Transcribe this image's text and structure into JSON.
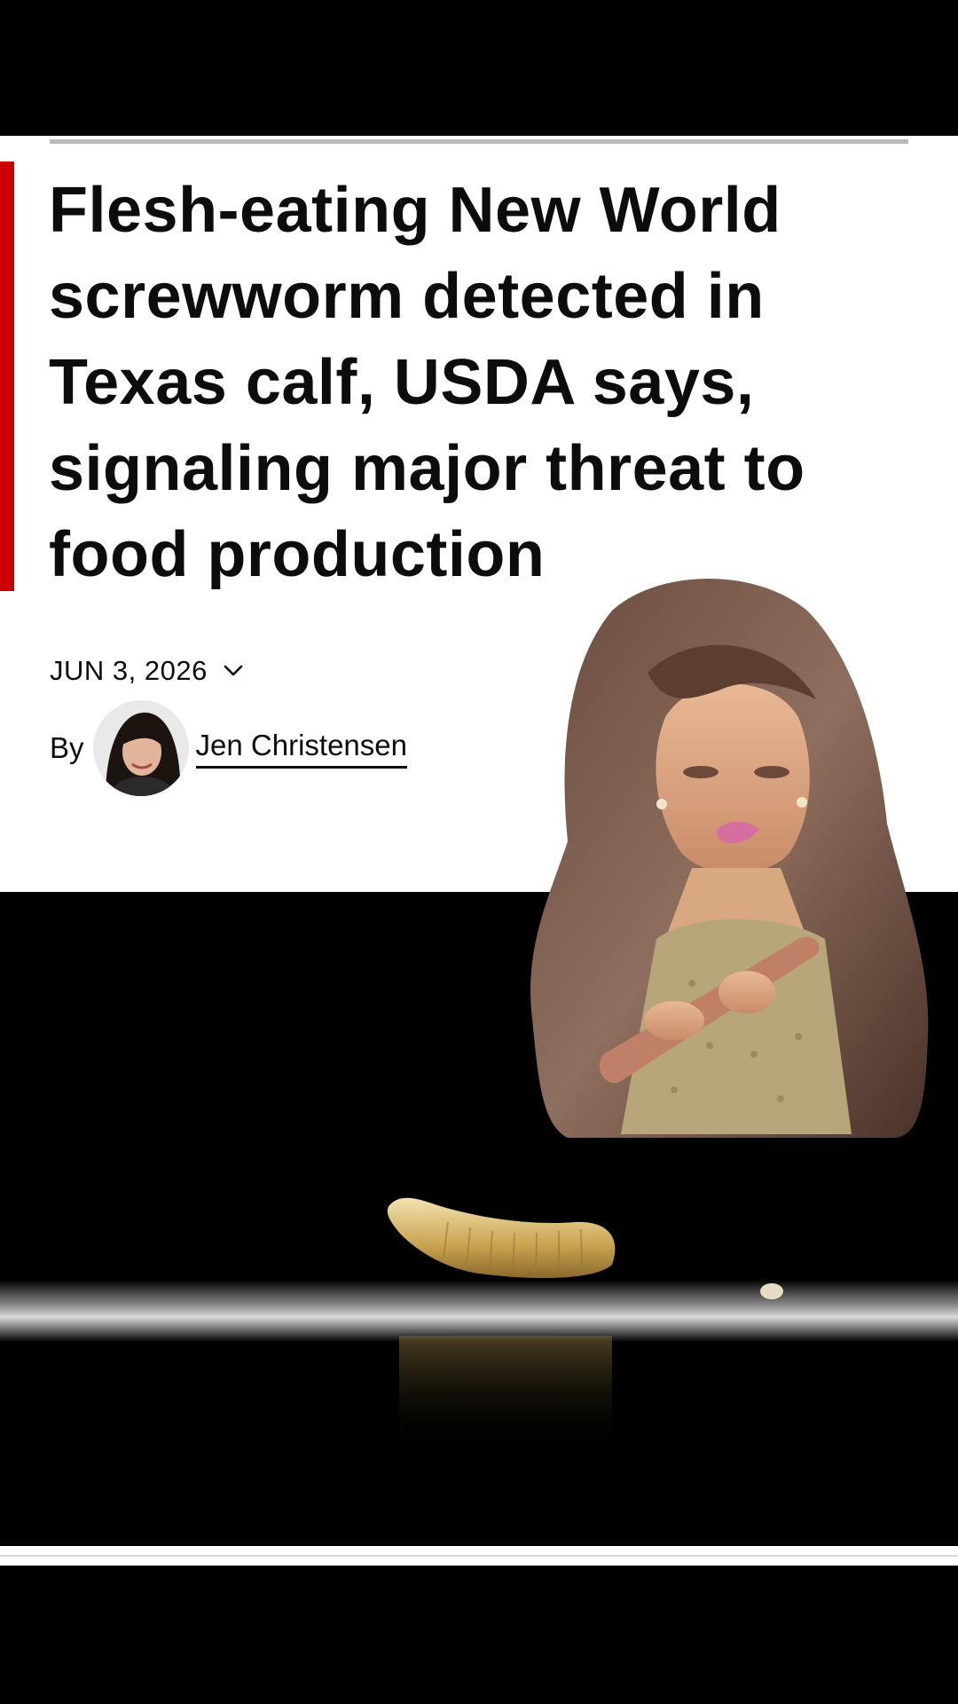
{
  "article": {
    "headline": "Flesh-eating New World screwworm detected in Texas calf, USDA says, signaling major threat to food production",
    "date": "JUN 3, 2026",
    "byline_prefix": "By",
    "author": "Jen Christensen"
  },
  "colors": {
    "accent": "#cc0000",
    "text": "#0c0c0c",
    "background": "#ffffff"
  },
  "icons": {
    "date_toggle": "chevron-down-icon"
  }
}
